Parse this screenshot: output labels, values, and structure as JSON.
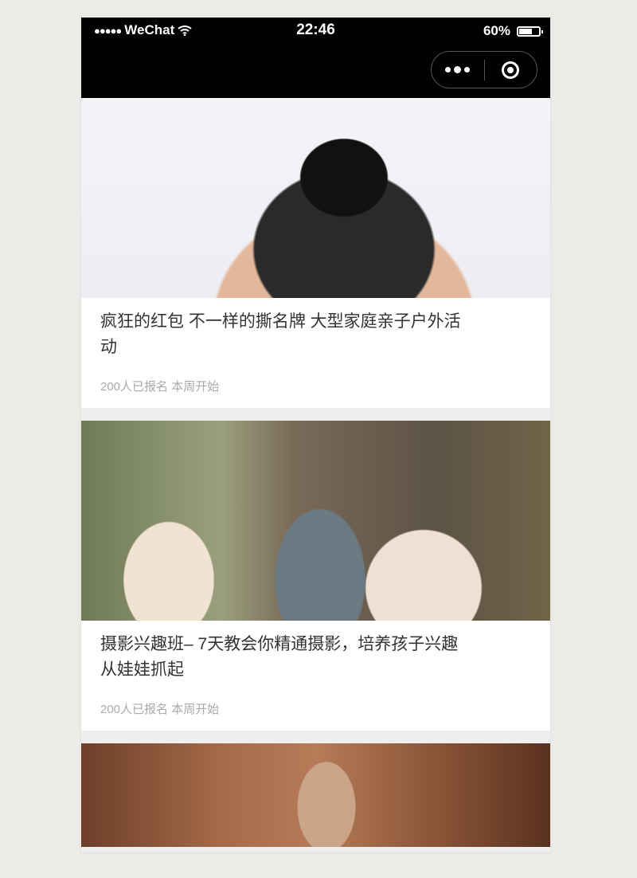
{
  "status_bar": {
    "signal": "●●●●●",
    "carrier": "WeChat",
    "wifi_icon": "wifi-icon",
    "time": "22:46",
    "battery_text": "60%",
    "battery_level": 0.6
  },
  "navbar": {
    "more_icon": "more-dots-icon",
    "close_icon": "target-close-icon"
  },
  "cards": [
    {
      "title": "疯狂的红包 不一样的撕名牌 大型家庭亲子户外活动",
      "meta": "200人已报名 本周开始"
    },
    {
      "title": "摄影兴趣班– 7天教会你精通摄影，培养孩子兴趣从娃娃抓起",
      "meta": "200人已报名 本周开始"
    }
  ]
}
